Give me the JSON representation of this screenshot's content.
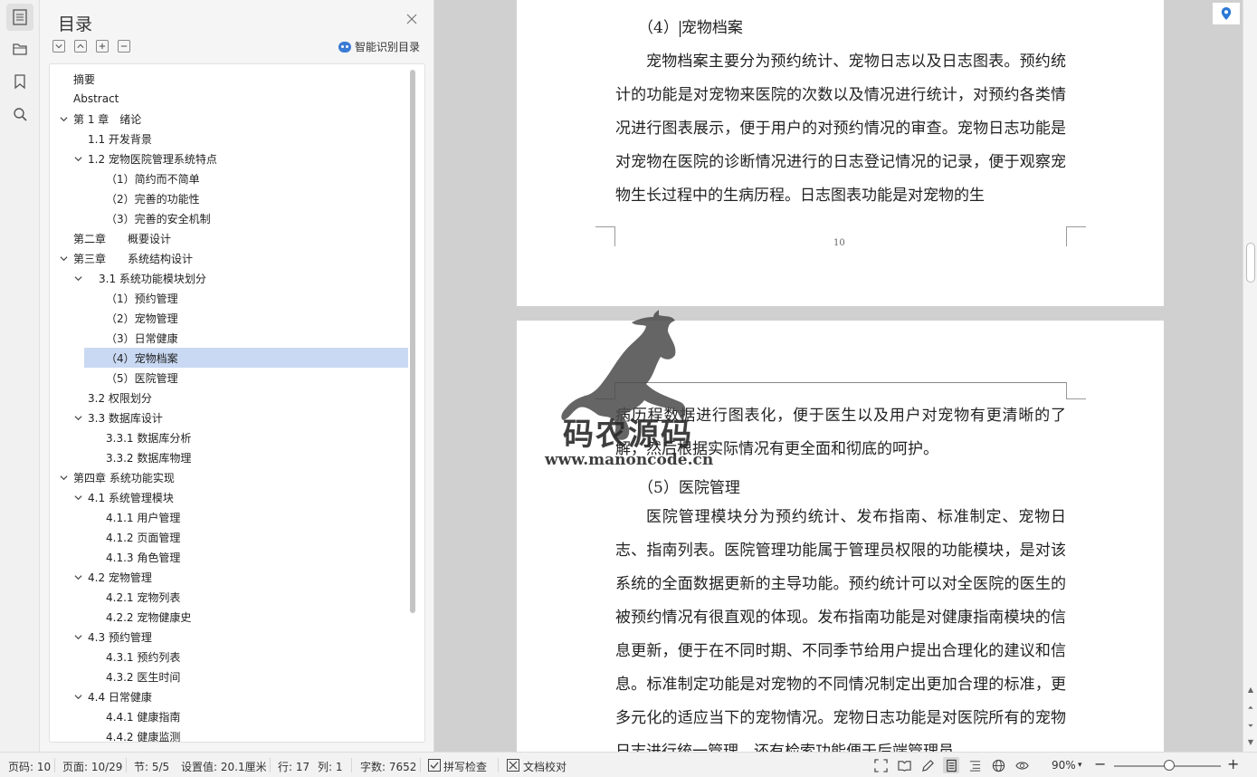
{
  "toc": {
    "title": "目录",
    "smart_label": "智能识别目录",
    "items": [
      {
        "label": "摘要",
        "level": 0,
        "chevron": false,
        "selected": false
      },
      {
        "label": "Abstract",
        "level": 0,
        "chevron": false,
        "selected": false
      },
      {
        "label": "第 1 章　绪论",
        "level": 0,
        "chevron": true,
        "selected": false
      },
      {
        "label": "1.1  开发背景",
        "level": 1,
        "chevron": false,
        "selected": false
      },
      {
        "label": "1.2 宠物医院管理系统特点",
        "level": 1,
        "chevron": true,
        "selected": false
      },
      {
        "label": "（1）简约而不简单",
        "level": 2,
        "chevron": false,
        "selected": false
      },
      {
        "label": "（2）完善的功能性",
        "level": 2,
        "chevron": false,
        "selected": false
      },
      {
        "label": "（3）完善的安全机制",
        "level": 2,
        "chevron": false,
        "selected": false
      },
      {
        "label": "第二章　　概要设计",
        "level": 0,
        "chevron": false,
        "selected": false
      },
      {
        "label": "第三章　　系统结构设计",
        "level": 0,
        "chevron": true,
        "selected": false
      },
      {
        "label": "3.1 系统功能模块划分",
        "level": 1.5,
        "chevron": true,
        "selected": false
      },
      {
        "label": "（1）预约管理",
        "level": 2,
        "chevron": false,
        "selected": false
      },
      {
        "label": "（2）宠物管理",
        "level": 2,
        "chevron": false,
        "selected": false
      },
      {
        "label": "（3）日常健康",
        "level": 2,
        "chevron": false,
        "selected": false
      },
      {
        "label": "（4）宠物档案",
        "level": 2,
        "chevron": false,
        "selected": true
      },
      {
        "label": "（5）医院管理",
        "level": 2,
        "chevron": false,
        "selected": false
      },
      {
        "label": "3.2 权限划分",
        "level": 1,
        "chevron": false,
        "selected": false
      },
      {
        "label": "3.3  数据库设计",
        "level": 1,
        "chevron": true,
        "selected": false
      },
      {
        "label": "3.3.1  数据库分析",
        "level": 2,
        "chevron": false,
        "selected": false
      },
      {
        "label": "3.3.2  数据库物理",
        "level": 2,
        "chevron": false,
        "selected": false
      },
      {
        "label": "第四章  系统功能实现",
        "level": 0,
        "chevron": true,
        "selected": false
      },
      {
        "label": "4.1  系统管理模块",
        "level": 1,
        "chevron": true,
        "selected": false
      },
      {
        "label": "4.1.1  用户管理",
        "level": 2,
        "chevron": false,
        "selected": false
      },
      {
        "label": "4.1.2  页面管理",
        "level": 2,
        "chevron": false,
        "selected": false
      },
      {
        "label": "4.1.3  角色管理",
        "level": 2,
        "chevron": false,
        "selected": false
      },
      {
        "label": "4.2  宠物管理",
        "level": 1,
        "chevron": true,
        "selected": false
      },
      {
        "label": "4.2.1  宠物列表",
        "level": 2,
        "chevron": false,
        "selected": false
      },
      {
        "label": "4.2.2  宠物健康史",
        "level": 2,
        "chevron": false,
        "selected": false
      },
      {
        "label": "4.3  预约管理",
        "level": 1,
        "chevron": true,
        "selected": false
      },
      {
        "label": "4.3.1  预约列表",
        "level": 2,
        "chevron": false,
        "selected": false
      },
      {
        "label": "4.3.2  医生时间",
        "level": 2,
        "chevron": false,
        "selected": false
      },
      {
        "label": "4.4  日常健康",
        "level": 1,
        "chevron": true,
        "selected": false
      },
      {
        "label": "4.4.1  健康指南",
        "level": 2,
        "chevron": false,
        "selected": false
      },
      {
        "label": "4.4.2 健康监测",
        "level": 2,
        "chevron": false,
        "selected": false
      }
    ]
  },
  "document": {
    "page1_heading": "（4）",
    "page1_heading_rest": "宠物档案",
    "page1_paragraph": "宠物档案主要分为预约统计、宠物日志以及日志图表。预约统计的功能是对宠物来医院的次数以及情况进行统计，对预约各类情况进行图表展示，便于用户的对预约情况的审查。宠物日志功能是对宠物在医院的诊断情况进行的日志登记情况的记录，便于观察宠物生长过程中的生病历程。日志图表功能是对宠物的生",
    "page1_number": "10",
    "page2_paragraph1": "病历程数据进行图表化，便于医生以及用户对宠物有更清晰的了解，然后根据实际情况有更全面和彻底的呵护。",
    "page2_heading": "（5）医院管理",
    "page2_paragraph2": "医院管理模块分为预约统计、发布指南、标准制定、宠物日志、指南列表。医院管理功能属于管理员权限的功能模块，是对该系统的全面数据更新的主导功能。预约统计可以对全医院的医生的被预约情况有很直观的体现。发布指南功能是对健康指南模块的信息更新，便于在不同时期、不同季节给用户提出合理化的建议和信息。标准制定功能是对宠物的不同情况制定出更加合理的标准，更多元化的适应当下的宠物情况。宠物日志功能是对医院所有的宠物日志进行统一管理，还有检索功能便于后端管理员"
  },
  "watermark": {
    "text": "码农源码",
    "url": "www.manoncode.cn"
  },
  "status": {
    "page_code": "页码: 10",
    "page": "页面: 10/29",
    "section": "节: 5/5",
    "setting": "设置值: 20.1厘米",
    "row": "行: 17",
    "col": "列: 1",
    "word_count": "字数: 7652",
    "spell_check": "拼写检查",
    "doc_proof": "文档校对",
    "zoom": "90%",
    "zoom_level_percent": 90
  },
  "colors": {
    "selected_bg": "#c9d9f3",
    "accent": "#3a7bd5"
  }
}
